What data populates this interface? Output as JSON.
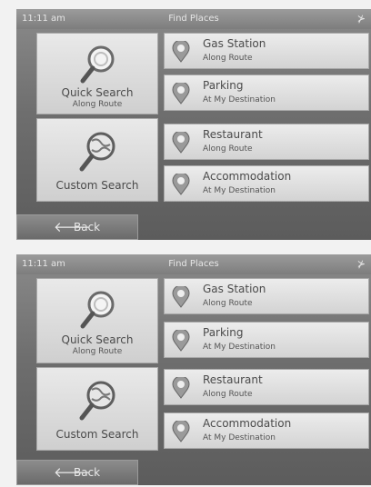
{
  "screens": [
    {
      "status": {
        "time": "11:11 am",
        "title": "Find Places"
      },
      "quick_search": {
        "label": "Quick Search",
        "sub": "Along Route"
      },
      "custom_search": {
        "label": "Custom Search"
      },
      "items": [
        {
          "name": "Gas Station",
          "sub": "Along Route"
        },
        {
          "name": "Parking",
          "sub": "At My Destination"
        },
        {
          "name": "Restaurant",
          "sub": "Along Route"
        },
        {
          "name": "Accommodation",
          "sub": "At My Destination"
        }
      ],
      "back_label": "Back"
    },
    {
      "status": {
        "time": "11:11 am",
        "title": "Find Places"
      },
      "quick_search": {
        "label": "Quick Search",
        "sub": "Along Route"
      },
      "custom_search": {
        "label": "Custom Search"
      },
      "items": [
        {
          "name": "Gas Station",
          "sub": "Along Route"
        },
        {
          "name": "Parking",
          "sub": "At My Destination"
        },
        {
          "name": "Restaurant",
          "sub": "Along Route"
        },
        {
          "name": "Accommodation",
          "sub": "At My Destination"
        }
      ],
      "back_label": "Back"
    }
  ]
}
